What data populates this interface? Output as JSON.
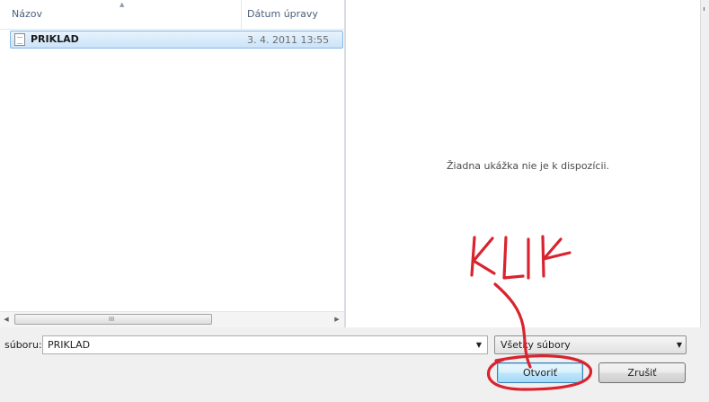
{
  "columns": {
    "name": "Názov",
    "date_modified": "Dátum úpravy"
  },
  "files": [
    {
      "name": "PRIKLAD",
      "date": "3. 4. 2011 13:55",
      "icon": "text-file-icon",
      "selected": true
    }
  ],
  "preview": {
    "message": "Žiadna ukážka nie je k dispozícii."
  },
  "scrollbar": {
    "grip": "III"
  },
  "filename_field": {
    "label": "súboru:",
    "value": "PRIKLAD"
  },
  "file_type": {
    "selected": "Všetky súbory"
  },
  "buttons": {
    "open": "Otvoriť",
    "cancel": "Zrušiť"
  },
  "annotation": {
    "text": "KLIK",
    "color": "#d9232e"
  },
  "colors": {
    "selection": "#cbe3f9",
    "accent_border": "#3c7fb1"
  }
}
